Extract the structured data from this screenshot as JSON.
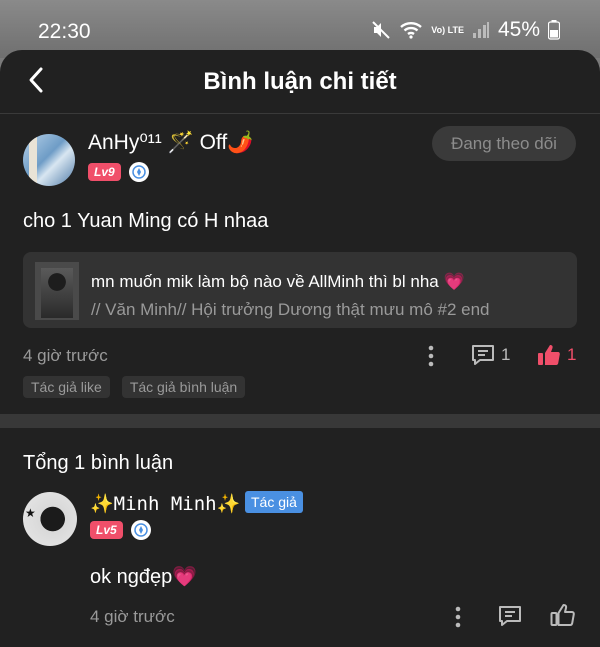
{
  "status": {
    "time": "22:30",
    "battery": "45%",
    "network": "Vo) LTE"
  },
  "header": {
    "title": "Bình luận chi tiết"
  },
  "post": {
    "username": "AnHy⁰¹¹ 🪄 Off🌶️",
    "level": "Lv9",
    "follow_label": "Đang theo dõi",
    "comment": "cho 1 Yuan Ming có H nhaa",
    "quote": {
      "line1": "mn muốn mik làm bộ nào về AllMinh thì bl nha 💗",
      "line2": "// Văn Minh// Hội trưởng Dương thật mưu mô #2 end"
    },
    "time": "4 giờ trước",
    "reply_count": "1",
    "like_count": "1",
    "tags": [
      "Tác giả like",
      "Tác giả bình luận"
    ]
  },
  "replies": {
    "total_label": "Tổng 1 bình luận",
    "items": [
      {
        "username": "✨Minh Minh✨",
        "author_tag": "Tác giả",
        "level": "Lv5",
        "text": "ok ngđẹp💗",
        "time": "4 giờ trước"
      }
    ]
  },
  "colors": {
    "accent": "#f04f6a",
    "author_tag": "#4a90e2",
    "background": "#212121"
  }
}
